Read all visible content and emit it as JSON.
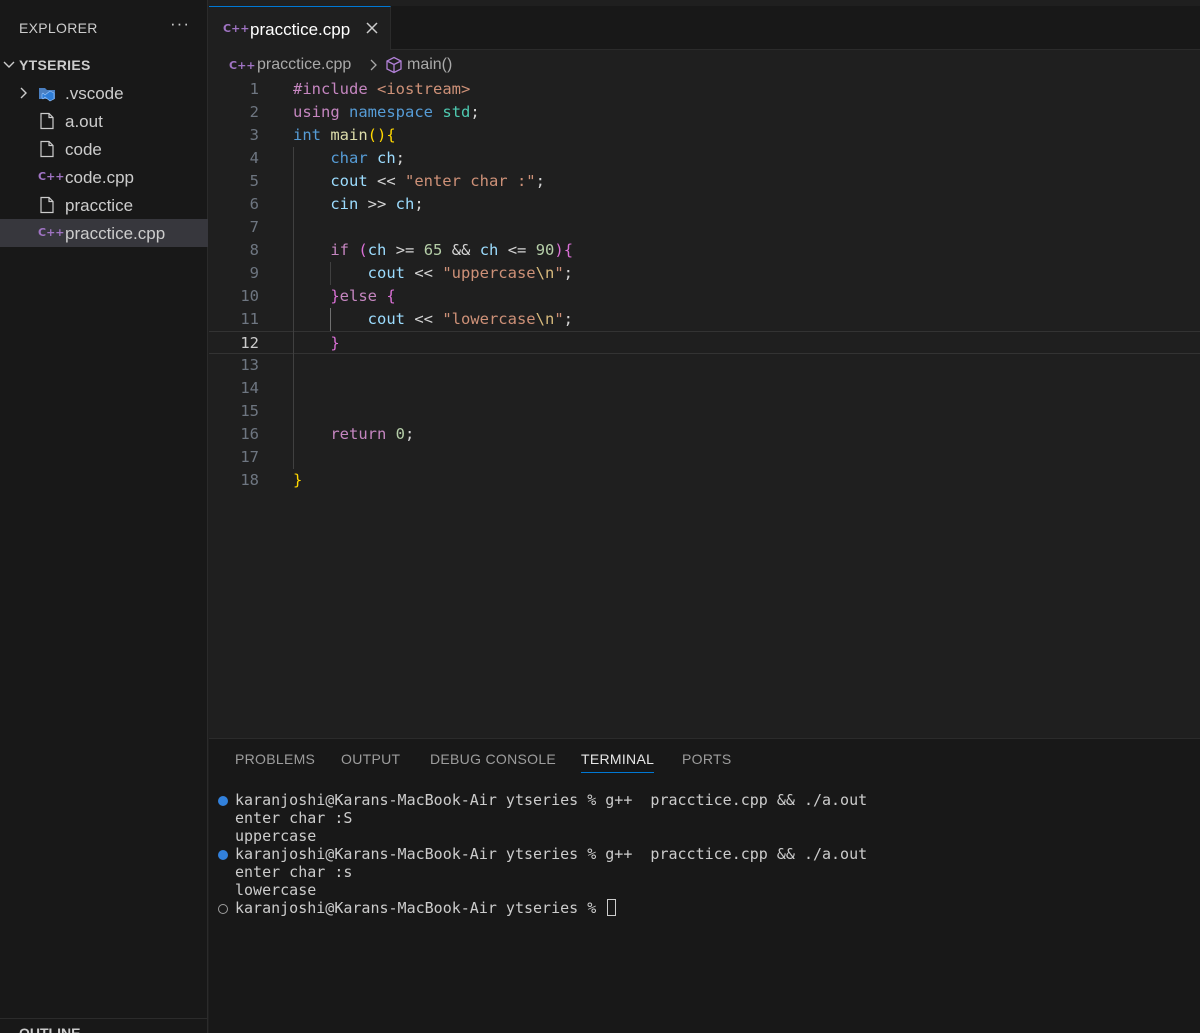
{
  "sidebar": {
    "title": "EXPLORER",
    "more": "···",
    "folder": "YTSERIES",
    "items": [
      {
        "label": ".vscode",
        "icon": "vscode-folder-icon"
      },
      {
        "label": "a.out",
        "icon": "file-icon"
      },
      {
        "label": "code",
        "icon": "file-icon"
      },
      {
        "label": "code.cpp",
        "icon": "cpp-file-icon"
      },
      {
        "label": "pracctice",
        "icon": "file-icon"
      },
      {
        "label": "pracctice.cpp",
        "icon": "cpp-file-icon",
        "selected": true
      }
    ],
    "outline": "OUTLINE"
  },
  "tabs": [
    {
      "label": "pracctice.cpp",
      "active": true
    }
  ],
  "cpp_glyph": "C++",
  "breadcrumb": {
    "file": "pracctice.cpp",
    "symbol": "main()"
  },
  "editor": {
    "active_line": 12,
    "line_numbers": [
      "1",
      "2",
      "3",
      "4",
      "5",
      "6",
      "7",
      "8",
      "9",
      "10",
      "11",
      "12",
      "13",
      "14",
      "15",
      "16",
      "17",
      "18"
    ]
  },
  "panel": {
    "tabs": [
      "PROBLEMS",
      "OUTPUT",
      "DEBUG CONSOLE",
      "TERMINAL",
      "PORTS"
    ],
    "active_tab": "TERMINAL",
    "terminal": [
      "karanjoshi@Karans-MacBook-Air ytseries % g++  pracctice.cpp && ./a.out",
      "enter char :S",
      "uppercase",
      "karanjoshi@Karans-MacBook-Air ytseries % g++  pracctice.cpp && ./a.out",
      "enter char :s",
      "lowercase",
      "karanjoshi@Karans-MacBook-Air ytseries % "
    ]
  },
  "colors": {
    "accent": "#0078d4",
    "cpp_icon": "#a074c4",
    "selected_row": "#37373d"
  }
}
